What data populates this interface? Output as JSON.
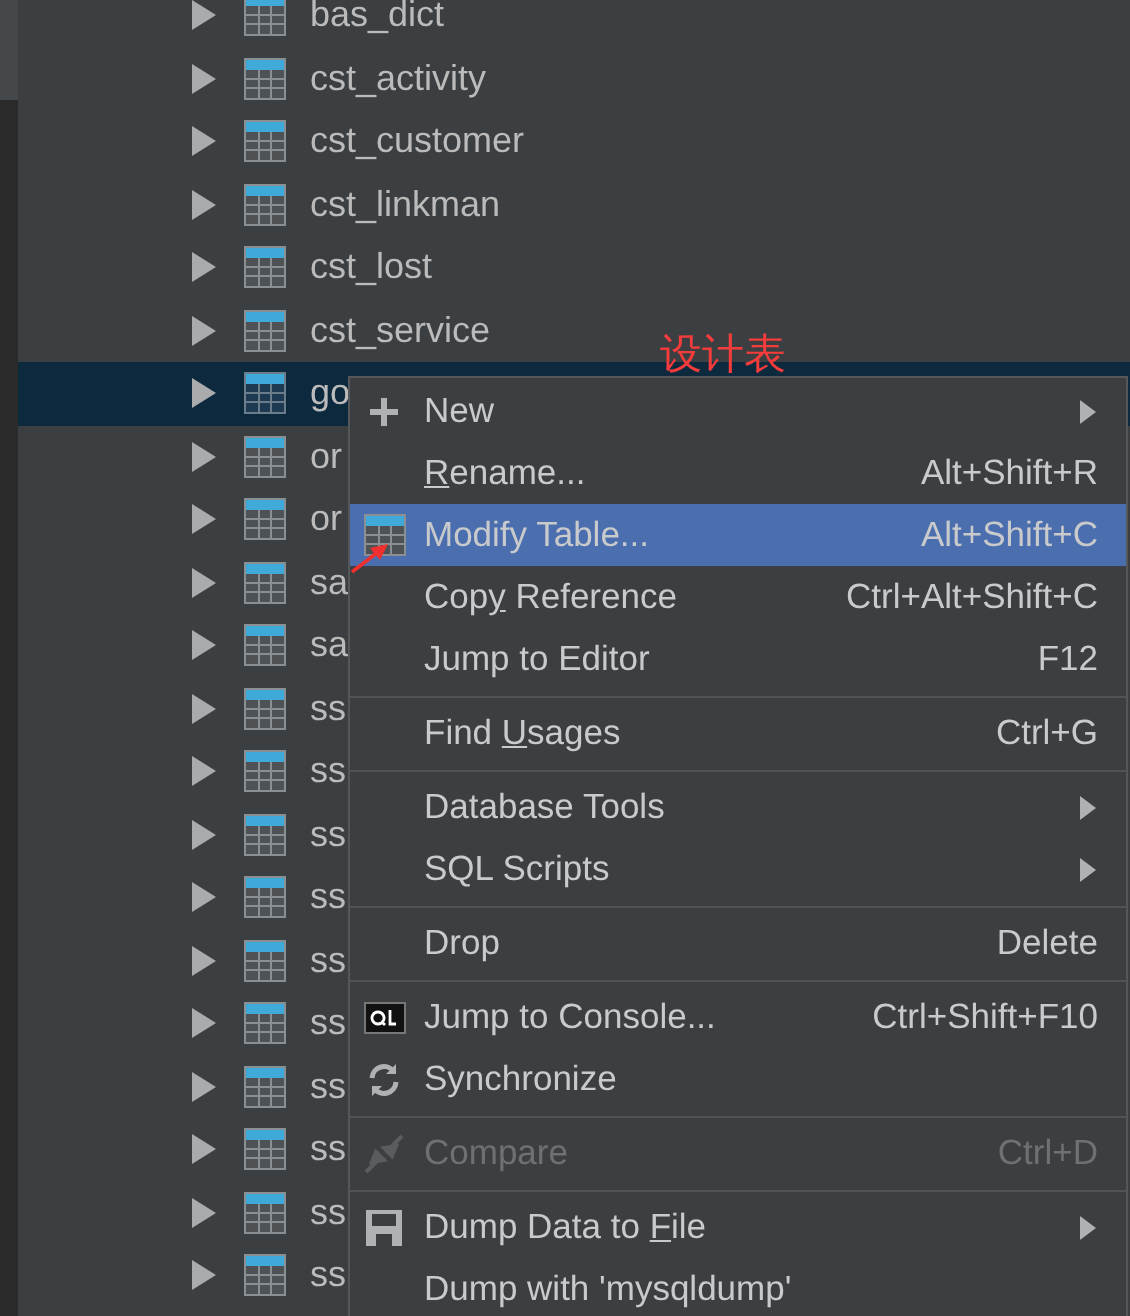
{
  "tree": {
    "items": [
      {
        "name": "bas_dict",
        "selected": false
      },
      {
        "name": "cst_activity",
        "selected": false
      },
      {
        "name": "cst_customer",
        "selected": false
      },
      {
        "name": "cst_linkman",
        "selected": false
      },
      {
        "name": "cst_lost",
        "selected": false
      },
      {
        "name": "cst_service",
        "selected": false
      },
      {
        "name": "go",
        "selected": true,
        "annotation": "设计表"
      },
      {
        "name": "or",
        "selected": false
      },
      {
        "name": "or",
        "selected": false
      },
      {
        "name": "sa",
        "selected": false
      },
      {
        "name": "sa",
        "selected": false
      },
      {
        "name": "ss",
        "selected": false
      },
      {
        "name": "ss",
        "selected": false
      },
      {
        "name": "ss",
        "selected": false
      },
      {
        "name": "ss",
        "selected": false
      },
      {
        "name": "ss",
        "selected": false
      },
      {
        "name": "ss",
        "selected": false
      },
      {
        "name": "ss",
        "selected": false
      },
      {
        "name": "ss",
        "selected": false
      },
      {
        "name": "ss",
        "selected": false
      },
      {
        "name": "ss",
        "selected": false
      }
    ]
  },
  "context_menu": {
    "groups": [
      [
        {
          "label": "New",
          "submenu": true,
          "selected": false,
          "disabled": false
        },
        {
          "underlined": "R",
          "label_end": "ename...",
          "shortcut": "Alt+Shift+R",
          "submenu": false,
          "selected": false,
          "disabled": false
        },
        {
          "label": "Modify Table...",
          "shortcut": "Alt+Shift+C",
          "submenu": false,
          "selected": true,
          "disabled": false
        },
        {
          "label": "Cop",
          "underlined": "y",
          "label_end": " Reference",
          "shortcut": "Ctrl+Alt+Shift+C",
          "submenu": false,
          "selected": false,
          "disabled": false
        },
        {
          "label": "Jump to Editor",
          "shortcut": "F12",
          "submenu": false,
          "selected": false,
          "disabled": false
        }
      ],
      [
        {
          "label": "Find ",
          "underlined": "U",
          "label_end": "sages",
          "shortcut": "Ctrl+G",
          "submenu": false,
          "selected": false,
          "disabled": false
        }
      ],
      [
        {
          "label": "Database Tools",
          "submenu": true,
          "selected": false,
          "disabled": false
        },
        {
          "label": "SQL Scripts",
          "submenu": true,
          "selected": false,
          "disabled": false
        }
      ],
      [
        {
          "label": "Drop",
          "shortcut": "Delete",
          "submenu": false,
          "selected": false,
          "disabled": false
        }
      ],
      [
        {
          "label": "Jump to Console...",
          "shortcut": "Ctrl+Shift+F10",
          "submenu": false,
          "selected": false,
          "disabled": false
        },
        {
          "label": "Synchronize",
          "submenu": false,
          "selected": false,
          "disabled": false
        }
      ],
      [
        {
          "label": "Compare",
          "shortcut": "Ctrl+D",
          "submenu": false,
          "selected": false,
          "disabled": true
        }
      ],
      [
        {
          "label": "Dump Data to ",
          "underlined": "F",
          "label_end": "ile",
          "submenu": true,
          "selected": false,
          "disabled": false
        },
        {
          "label": "Dump with 'mysqldump'",
          "submenu": false,
          "selected": false,
          "disabled": false
        }
      ]
    ]
  }
}
